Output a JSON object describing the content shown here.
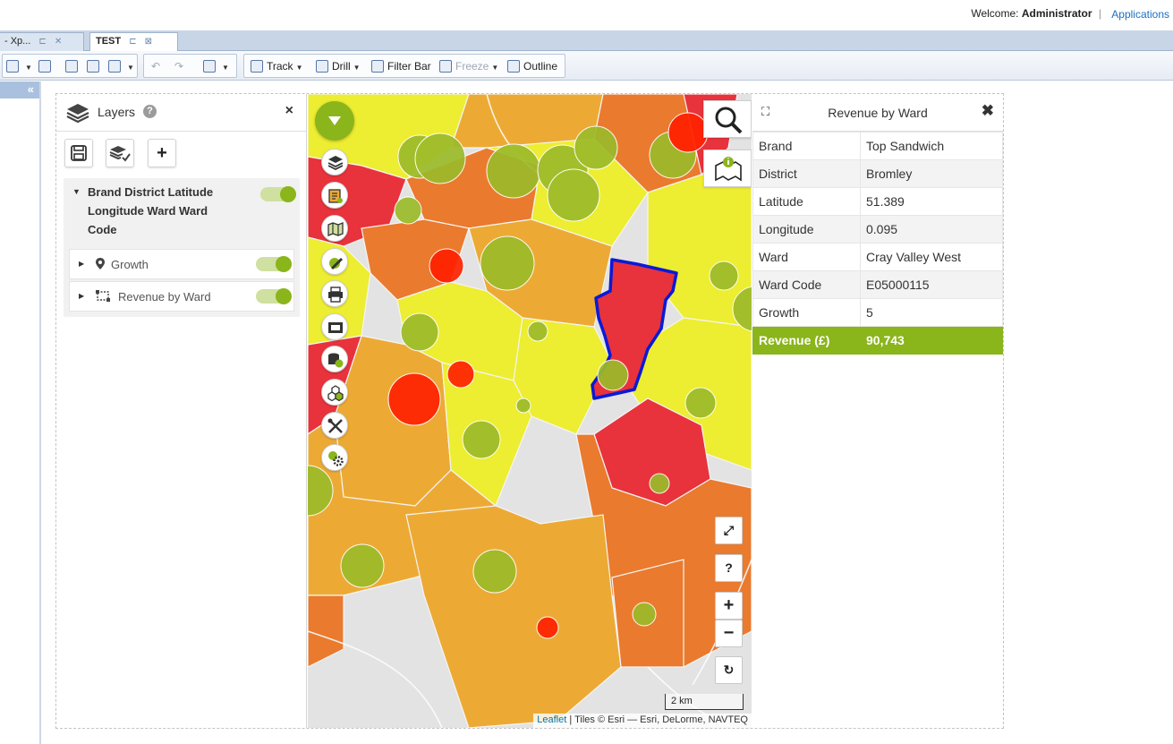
{
  "header": {
    "welcome_label": "Welcome:",
    "user": "Administrator",
    "separator": "|",
    "applications_link": "Applications"
  },
  "tabs": [
    {
      "label": "- Xp..."
    },
    {
      "label": "TEST"
    }
  ],
  "toolbar": {
    "track": "Track",
    "drill": "Drill",
    "filter_bar": "Filter Bar",
    "freeze": "Freeze",
    "outline": "Outline"
  },
  "leftstrip": {
    "collapse": "«"
  },
  "layers_panel": {
    "title": "Layers",
    "help": "?",
    "close": "×",
    "group_title": "Brand District Latitude Longitude Ward Ward Code",
    "sublayers": [
      {
        "label": "Growth",
        "icon": "marker-icon",
        "enabled": true
      },
      {
        "label": "Revenue by Ward",
        "icon": "polygon-icon",
        "enabled": true
      }
    ],
    "group_enabled": true
  },
  "map": {
    "zoom_in": "+",
    "zoom_out": "−",
    "fullscreen": "⤢",
    "help": "?",
    "reset": "↻",
    "scale": "2 km",
    "attribution_leaflet": "Leaflet",
    "attribution_tiles": "| Tiles © Esri — Esri, DeLorme, NAVTEQ",
    "colors": {
      "high": "#e8323c",
      "red_bright": "#ff2200",
      "orange": "#ea7a2e",
      "amber": "#ecaa35",
      "yellow": "#eded32",
      "bubble": "#9cbb2a",
      "selection": "#0a1ad6"
    }
  },
  "info_panel": {
    "title": "Revenue by Ward",
    "close": "✖",
    "expand": "⛶",
    "rows": [
      {
        "key": "Brand",
        "value": "Top Sandwich"
      },
      {
        "key": "District",
        "value": "Bromley"
      },
      {
        "key": "Latitude",
        "value": "51.389"
      },
      {
        "key": "Longitude",
        "value": "0.095"
      },
      {
        "key": "Ward",
        "value": "Cray Valley West"
      },
      {
        "key": "Ward Code",
        "value": "E05000115"
      },
      {
        "key": "Growth",
        "value": "5"
      },
      {
        "key": "Revenue (£)",
        "value": "90,743"
      }
    ],
    "highlight_color": "#8ab51b"
  }
}
